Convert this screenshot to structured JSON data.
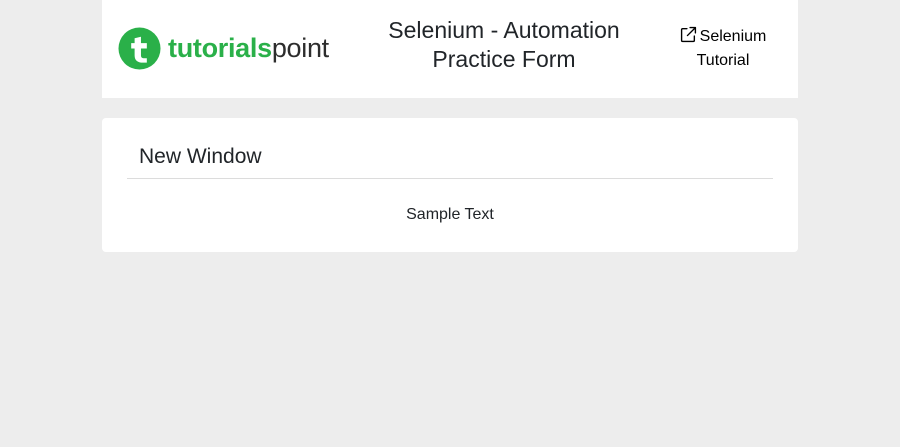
{
  "header": {
    "logo": {
      "brand_part1": "tutorials",
      "brand_part2": "point",
      "icon": "tutorialspoint-logo-icon",
      "brand_color": "#2ab049"
    },
    "title_line1": "Selenium - Automation",
    "title_line2": "Practice Form",
    "tutorial_link": {
      "line1": "Selenium",
      "line2": "Tutorial",
      "icon": "external-link-icon"
    }
  },
  "card": {
    "title": "New Window",
    "body_text": "Sample Text"
  },
  "colors": {
    "page_background": "#ededed",
    "panel_background": "#ffffff",
    "text": "#212529",
    "divider": "#dcdcdc"
  }
}
